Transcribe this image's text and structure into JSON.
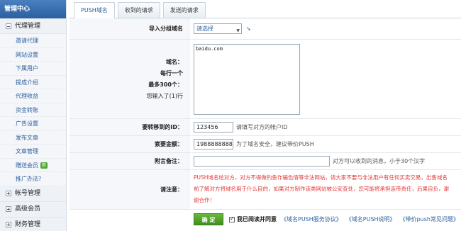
{
  "sidebar": {
    "header": "管理中心",
    "groups": [
      {
        "label": "代理管理",
        "expanded": true
      },
      {
        "label": "帐号管理",
        "expanded": false
      },
      {
        "label": "高级会员",
        "expanded": false
      },
      {
        "label": "财务管理",
        "expanded": false
      }
    ],
    "items": [
      "邀请代理",
      "网站设置",
      "下属用户",
      "提成介绍",
      "代理收益",
      "资金转账",
      "广告设置",
      "发布文章",
      "文章管理",
      "赠送会员",
      "推广办法?"
    ],
    "new_badge": "新"
  },
  "tabs": [
    "PUSH域名",
    "收到的请求",
    "发送的请求"
  ],
  "form": {
    "group_label": "导入分组域名",
    "group_select": "请选择",
    "domain_label_1": "域名：",
    "domain_label_2": "每行一个",
    "domain_label_3": "最多300个：",
    "domain_label_4": "您输入了(1)行",
    "domain_value": "baidu.com",
    "target_id_label": "要转移到的ID：",
    "target_id_value": "123456",
    "target_id_hint": "请填写对方的帐户ID",
    "amount_label": "索要金额：",
    "amount_value": "1988888888",
    "amount_hint": "为了域名安全，建议带价PUSH",
    "note_label": "附言备注：",
    "note_value": "",
    "note_hint": "对方可以收到的消息，小于30个汉字",
    "notice_label": "请注意：",
    "notice_line1": "PUSH域名给对方，对方不得做钓鱼诈骗色情等非法网站，请大家不要与非法用户有任何买卖交易，出售域名",
    "notice_line2": "前了解对方将域名用于什么目的，如果对方制作该类网站被公安查处，您可能将承担连带责任，后果自负，谢",
    "notice_line3": "谢合作！",
    "submit": "确 定",
    "agree": "我已阅读并同意",
    "link1": "《域名PUSH服务协议》",
    "link2": "《域名PUSH说明》",
    "link3": "《带价push常见问题》"
  },
  "colors": {
    "accent": "#2b5f9e",
    "warning": "#e03b3b",
    "ok": "#4a9e2a"
  }
}
